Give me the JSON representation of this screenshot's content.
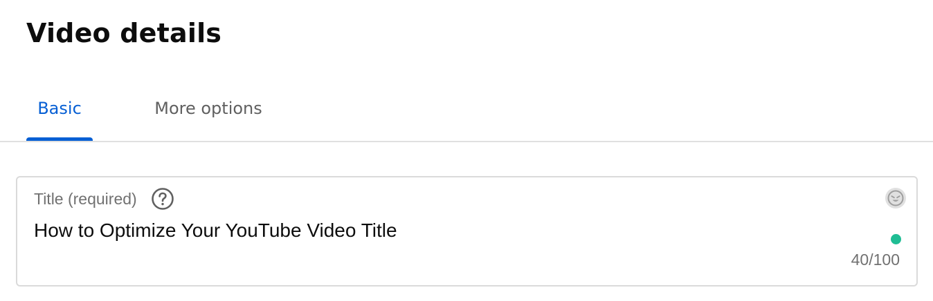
{
  "header": {
    "title": "Video details"
  },
  "tabs": [
    {
      "label": "Basic",
      "selected": true
    },
    {
      "label": "More options",
      "selected": false
    }
  ],
  "title_field": {
    "label": "Title (required)",
    "value": "How to Optimize Your YouTube Video Title",
    "char_count": "40/100",
    "status_color": "#1fbd94"
  },
  "icons": {
    "help": "help-circle-icon",
    "emoji": "emoji-picker-icon"
  },
  "colors": {
    "accent": "#065fd4",
    "tab_inactive": "#606060",
    "status_ok": "#1fbd94"
  }
}
